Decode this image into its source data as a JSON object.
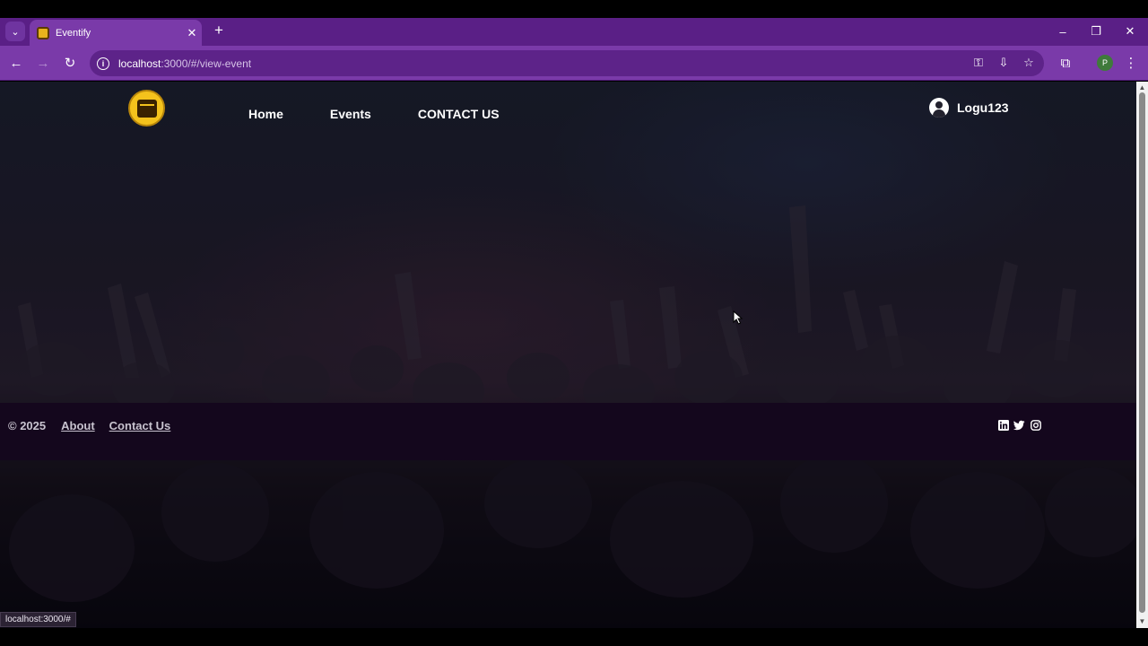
{
  "browser": {
    "tab_title": "Eventify",
    "tab_close": "✕",
    "new_tab": "+",
    "url_host": "localhost",
    "url_path": ":3000/#/view-event",
    "status_url": "localhost:3000/#",
    "profile_initial": "P",
    "window_controls": [
      "minimize-icon",
      "restore-icon",
      "close-icon"
    ]
  },
  "navbar": {
    "logo_icon": "calendar-icon",
    "links": [
      "Home",
      "Events",
      "CONTACT US"
    ],
    "username": "Logu123",
    "user_icon": "user-circle-icon"
  },
  "footer": {
    "copyright": "© 2025",
    "links": [
      "About",
      "Contact Us"
    ],
    "socials": [
      "linkedin-icon",
      "twitter-icon",
      "instagram-icon"
    ]
  },
  "colors": {
    "chrome_tabbar": "#5a1f86",
    "chrome_toolbar": "#7a3aa9",
    "logo_yellow": "#f4c21c",
    "footer_bg": "#14071d"
  }
}
